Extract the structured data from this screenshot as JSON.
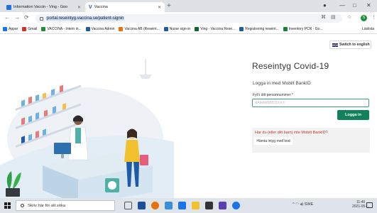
{
  "tabs": [
    {
      "label": "Information Vaccin - Ving - Goo",
      "icon": "docs-icon"
    },
    {
      "label": "Vaccina",
      "icon": "vaccina-icon"
    }
  ],
  "browser": {
    "url": "portal.reseintyg.vaccina.se/patient-signin"
  },
  "bookmarks": {
    "items": [
      {
        "label": "Appar",
        "color": "#1a73e8"
      },
      {
        "label": "Gmail",
        "color": "#d93025"
      },
      {
        "label": "VACCINA - Intern in...",
        "color": "#1e8e3e"
      },
      {
        "label": "Vaccina Admin",
        "color": "#1f5aa6"
      },
      {
        "label": "Vaccina AB (Reseint...",
        "color": "#e8710a"
      },
      {
        "label": "Nurse sign-in",
        "color": "#1f5aa6"
      },
      {
        "label": "Ving - Vaccina Rese...",
        "color": "#0d652d"
      },
      {
        "label": "Registrering reseint...",
        "color": "#1f5aa6"
      },
      {
        "label": "Inventory PCR - Go...",
        "color": "#188038"
      }
    ],
    "other": "Läslista"
  },
  "page": {
    "switch_lang": "Switch to english",
    "title": "Reseintyg Covid-19",
    "subtitle": "Logga in med Mobilt BankID",
    "pnr_label": "Fyll i ditt personnummer *",
    "pnr_placeholder": "ÅÅÅÅMMDDXXXX",
    "login_label": "Logga in",
    "no_bankid": "Har du (eller ditt barn) inte Mobilt BankID?",
    "fetch_label": "Hämta intyg med kod"
  },
  "taskbar": {
    "search_placeholder": "Skriv här för att söka",
    "lang": "SWE",
    "time": "11:40",
    "date": "2021-05-..."
  },
  "colors": {
    "accent": "#12805a",
    "link": "#c0392b"
  }
}
